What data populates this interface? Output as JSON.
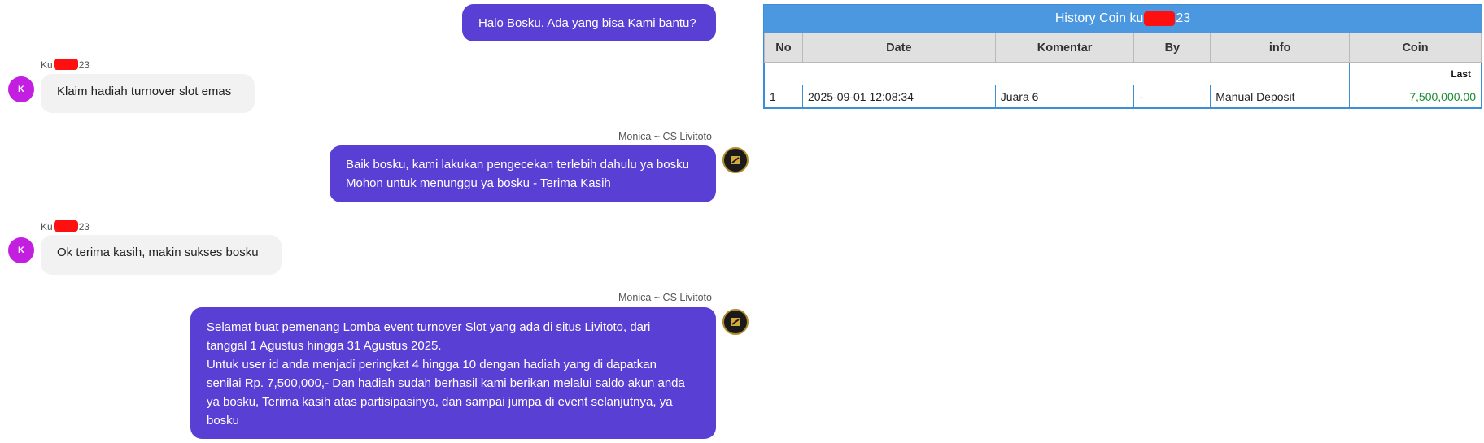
{
  "messages": {
    "m1": {
      "lines": [
        "Halo Bosku. Ada yang bisa Kami bantu?"
      ]
    },
    "m2": {
      "sender_prefix": "Ku",
      "sender_suffix": "23",
      "avatar": "K",
      "lines": [
        "Klaim hadiah turnover slot emas"
      ]
    },
    "m3": {
      "agent": "Monica ~ CS Livitoto",
      "lines": [
        "Baik bosku, kami lakukan pengecekan terlebih dahulu ya bosku",
        "Mohon untuk menunggu ya bosku - Terima Kasih"
      ]
    },
    "m4": {
      "sender_prefix": "Ku",
      "sender_suffix": "23",
      "avatar": "K",
      "lines": [
        "Ok terima kasih, makin sukses bosku"
      ]
    },
    "m5": {
      "agent": "Monica ~ CS Livitoto",
      "lines": [
        "Selamat buat pemenang Lomba event turnover Slot yang ada di situs Livitoto, dari",
        "tanggal 1 Agustus hingga 31 Agustus 2025.",
        "Untuk user id anda menjadi peringkat 4 hingga 10 dengan hadiah yang di dapatkan",
        "senilai Rp. 7,500,000,- Dan hadiah sudah berhasil kami berikan melalui saldo akun anda",
        "ya bosku, Terima kasih atas partisipasinya, dan sampai jumpa di event selanjutnya, ya",
        "bosku"
      ]
    }
  },
  "history": {
    "title_prefix": "History Coin ku",
    "title_suffix": "23",
    "columns": [
      "No",
      "Date",
      "Komentar",
      "By",
      "info",
      "Coin"
    ],
    "last_label": "Last",
    "rows": [
      {
        "no": "1",
        "date": "2025-09-01 12:08:34",
        "komentar": "Juara 6",
        "by": "-",
        "info": "Manual Deposit",
        "coin": "7,500,000.00"
      }
    ],
    "coin_color": "#1a8a33",
    "header_color": "#4b97e0"
  },
  "colors": {
    "outgoing_bubble": "#5a3fd4",
    "incoming_bubble": "#f2f2f2",
    "user_avatar": "#c21fe0"
  }
}
